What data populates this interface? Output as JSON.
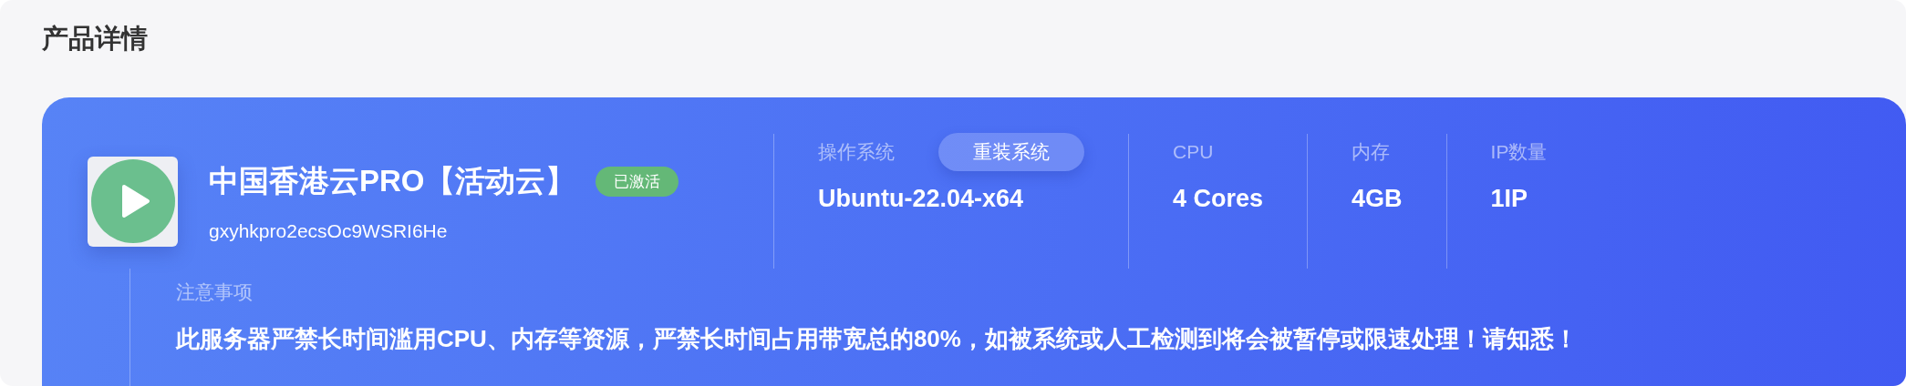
{
  "page": {
    "title": "产品详情"
  },
  "product": {
    "name": "中国香港云PRO【活动云】",
    "status": "已激活",
    "id": "gxyhkpro2ecsOc9WSRI6He"
  },
  "specs": [
    {
      "label": "操作系统",
      "value": "Ubuntu-22.04-x64",
      "action": "重装系统"
    },
    {
      "label": "CPU",
      "value": "4 Cores"
    },
    {
      "label": "内存",
      "value": "4GB"
    },
    {
      "label": "IP数量",
      "value": "1IP"
    }
  ],
  "notice": {
    "label": "注意事项",
    "text": "此服务器严禁长时间滥用CPU、内存等资源，严禁长时间占用带宽总的80%，如被系统或人工检测到将会被暂停或限速处理！请知悉！"
  }
}
